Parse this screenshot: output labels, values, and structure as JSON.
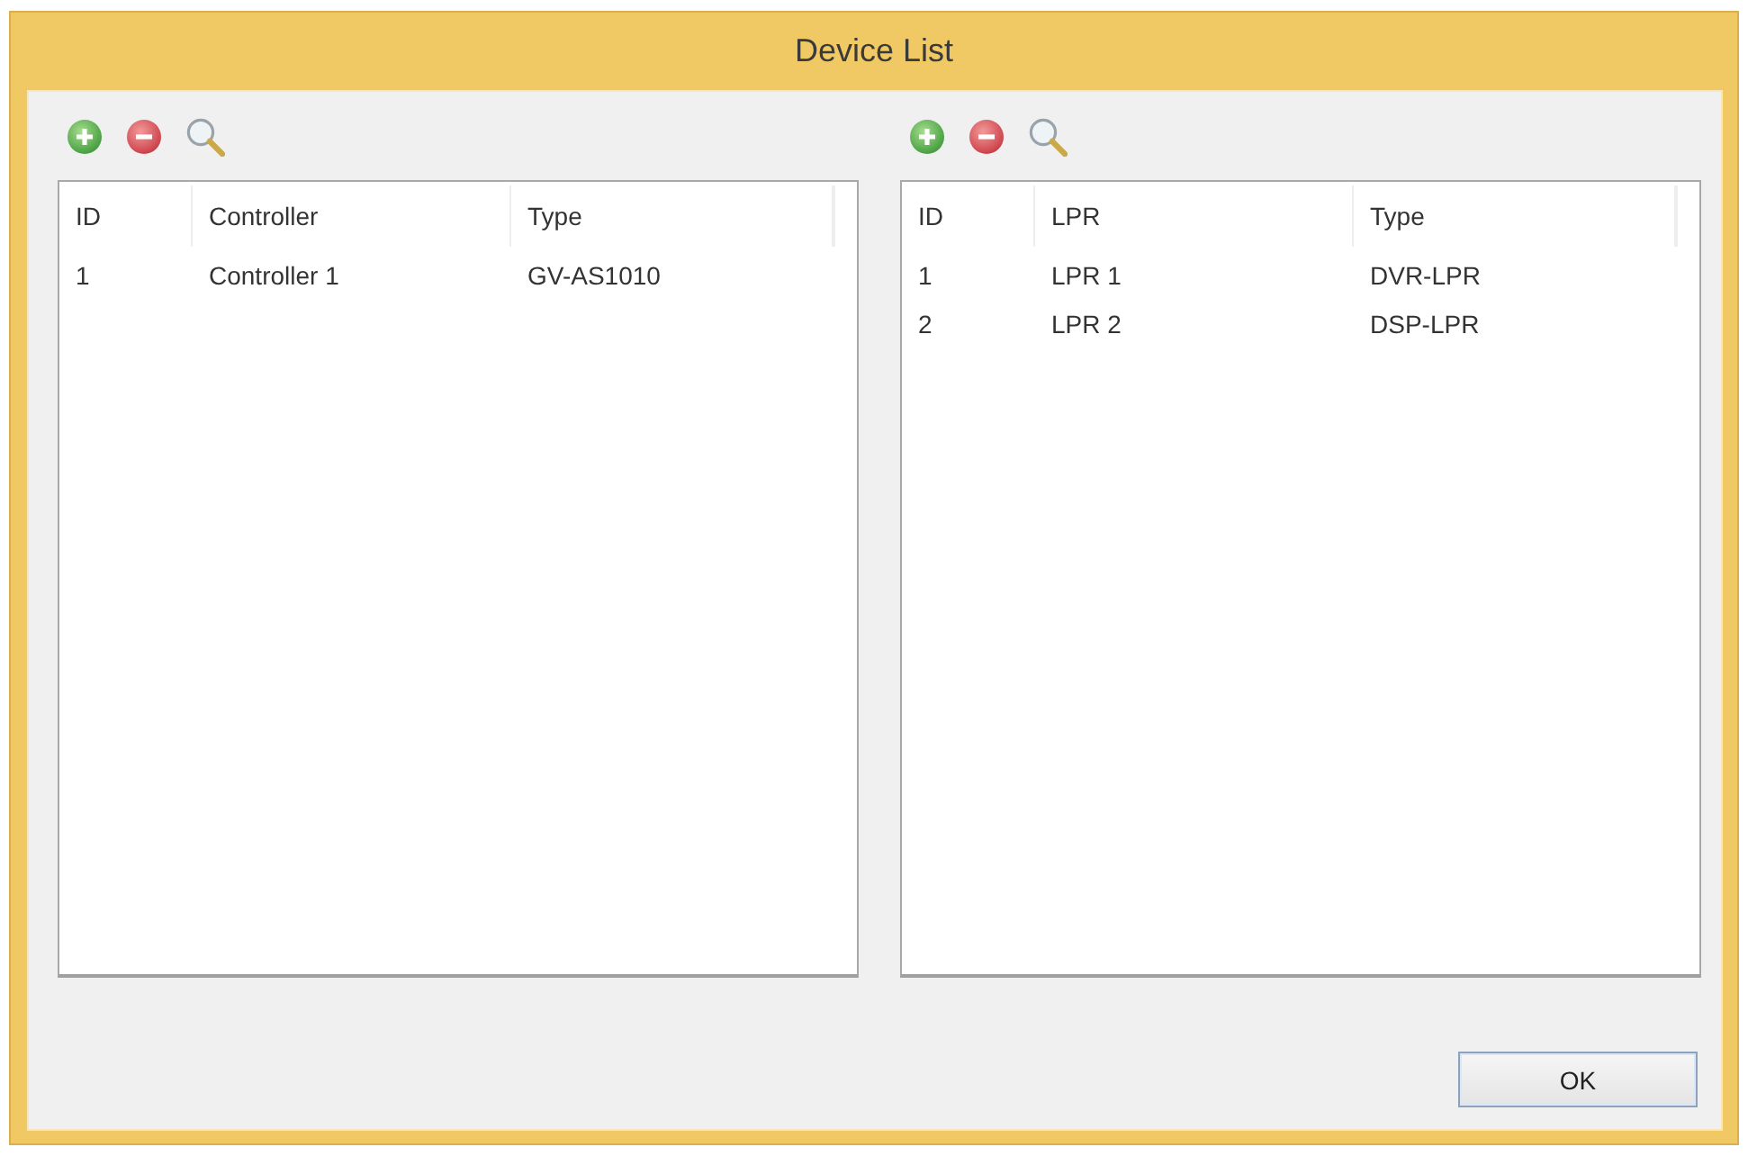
{
  "window": {
    "title": "Device List"
  },
  "panels": [
    {
      "table": {
        "columns": [
          "ID",
          "Controller",
          "Type"
        ],
        "rows": [
          [
            "1",
            "Controller 1",
            "GV-AS1010"
          ]
        ]
      }
    },
    {
      "table": {
        "columns": [
          "ID",
          "LPR",
          "Type"
        ],
        "rows": [
          [
            "1",
            "LPR 1",
            "DVR-LPR"
          ],
          [
            "2",
            "LPR 2",
            "DSP-LPR"
          ]
        ]
      }
    }
  ],
  "buttons": [
    "OK"
  ]
}
